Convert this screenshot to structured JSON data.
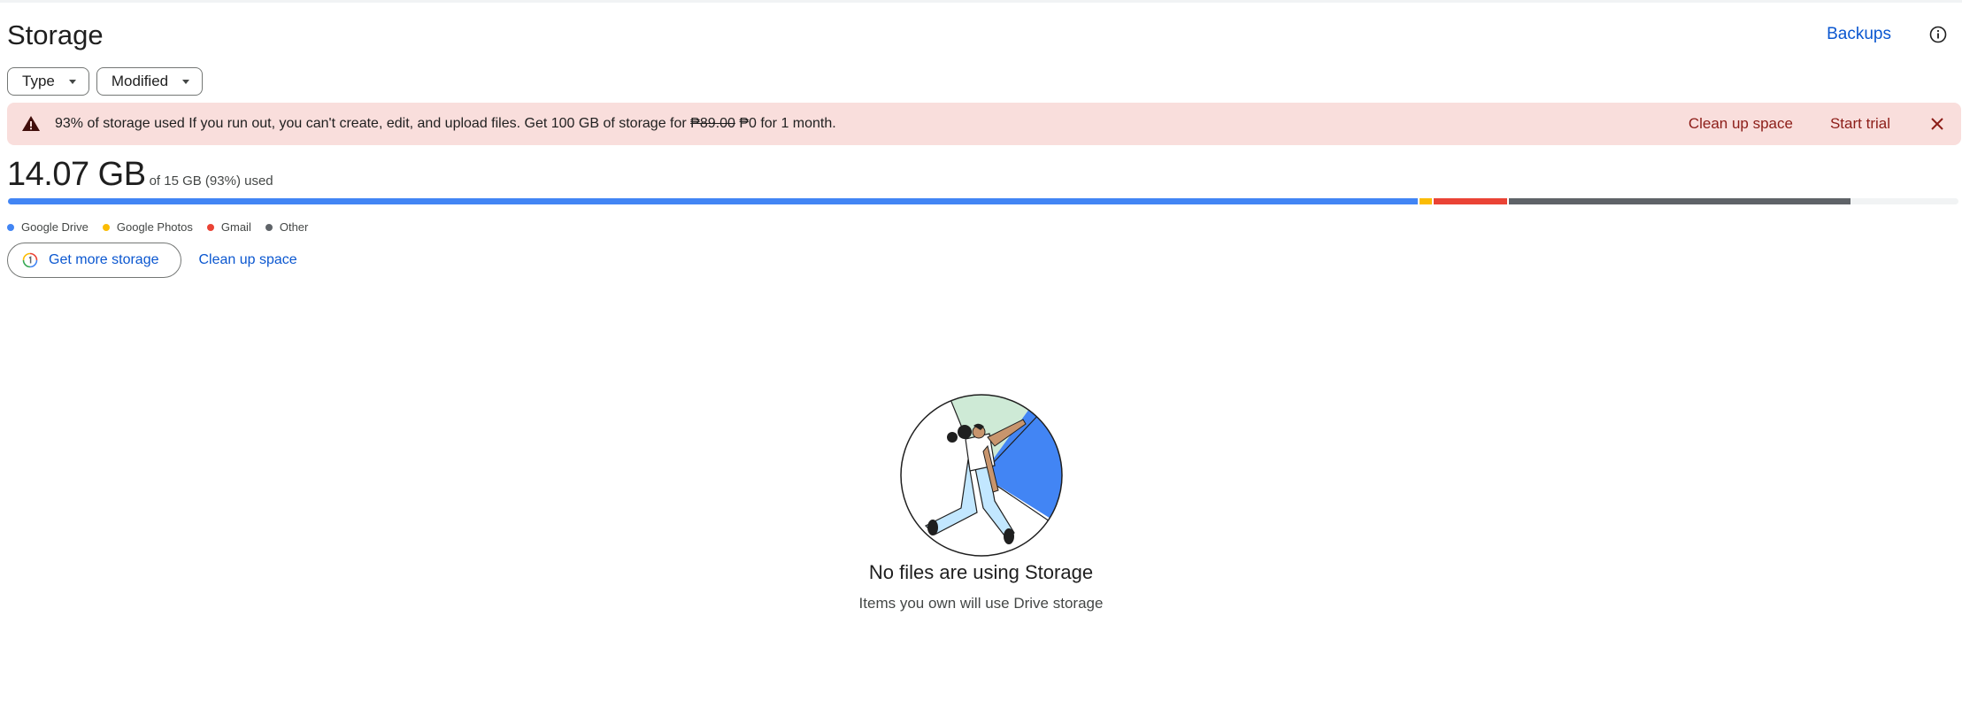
{
  "page": {
    "title": "Storage"
  },
  "header": {
    "backups_label": "Backups",
    "info_icon": "info-icon"
  },
  "filters": {
    "type_label": "Type",
    "modified_label": "Modified"
  },
  "banner": {
    "icon": "warning-icon",
    "bold": "93% of storage used",
    "text": " If you run out, you can't create, edit, and upload files. Get 100 GB of storage for ",
    "old_price": "₱89.00",
    "new_price": " ₱0 for 1 month.",
    "cleanup_label": "Clean up space",
    "trial_label": "Start trial",
    "close_icon": "close-icon",
    "bg_color": "#f9dedc",
    "action_color": "#8c1d18"
  },
  "usage": {
    "amount": "14.07 GB",
    "of_text": "of 15 GB (93%) used",
    "percent_used": 93
  },
  "bar": {
    "segments": [
      {
        "name": "Google Drive",
        "fraction": 0.723,
        "color": "#4285f4"
      },
      {
        "name": "Google Photos",
        "fraction": 0.006,
        "color": "#fbbc04"
      },
      {
        "name": "Gmail",
        "fraction": 0.038,
        "color": "#ea4335"
      },
      {
        "name": "Other",
        "fraction": 0.175,
        "color": "#5f6368"
      }
    ]
  },
  "legend": {
    "items": [
      {
        "label": "Google Drive",
        "color": "#4285f4"
      },
      {
        "label": "Google Photos",
        "color": "#fbbc04"
      },
      {
        "label": "Gmail",
        "color": "#ea4335"
      },
      {
        "label": "Other",
        "color": "#5f6368"
      }
    ]
  },
  "actions": {
    "get_storage_label": "Get more storage",
    "cleanup_label": "Clean up space",
    "google_one_icon": "google-one-icon"
  },
  "empty_state": {
    "title": "No files are using Storage",
    "subtitle": "Items you own will use Drive storage",
    "illustration": "person-pushing-pie-illustration"
  }
}
